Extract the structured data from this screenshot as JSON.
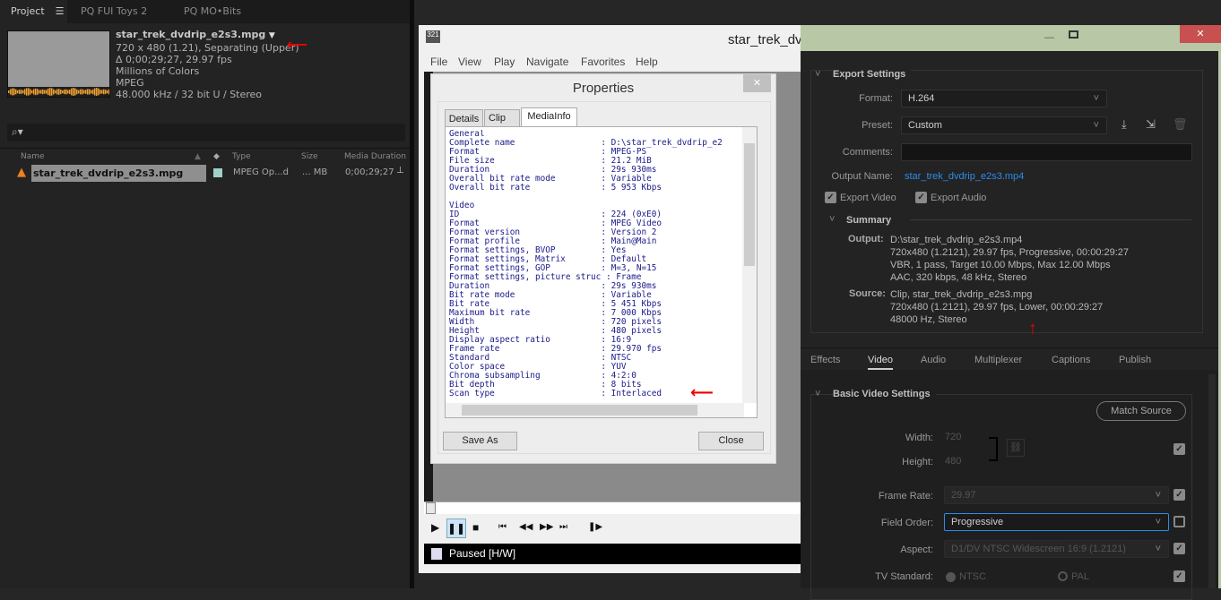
{
  "project_panel": {
    "tabs": [
      "Project",
      "PQ FUI Toys 2",
      "PQ MO•Bits"
    ],
    "menu_icon": "hamburger-icon",
    "clip_name": "star_trek_dvdrip_e2s3.mpg",
    "info_lines": [
      "720 x 480 (1.21), Separating (Upper)",
      "Δ 0;00;29;27, 29.97 fps",
      "Millions of Colors",
      "MPEG",
      "48.000 kHz / 32 bit U / Stereo"
    ],
    "columns": [
      "Name",
      "Type",
      "Size",
      "Media Duration"
    ],
    "rows": [
      {
        "name": "star_trek_dvdrip_e2s3.mpg",
        "type": "MPEG Op...d",
        "size": "... MB",
        "duration": "0;00;29;27",
        "label_color": "#9fd0c9"
      }
    ],
    "waveform_color": "#f0a030"
  },
  "mpc": {
    "title": "star_trek_dvd",
    "menu": [
      "File",
      "View",
      "Play",
      "Navigate",
      "Favorites",
      "Help"
    ],
    "status": "Paused [H/W]"
  },
  "properties": {
    "title": "Properties",
    "tabs": [
      "Details",
      "Clip",
      "MediaInfo"
    ],
    "active_tab": "MediaInfo",
    "mediainfo_text": "General\nComplete name                 : D:\\star_trek_dvdrip_e2\nFormat                        : MPEG-PS\nFile size                     : 21.2 MiB\nDuration                      : 29s 930ms\nOverall bit rate mode         : Variable\nOverall bit rate              : 5 953 Kbps\n\nVideo\nID                            : 224 (0xE0)\nFormat                        : MPEG Video\nFormat version                : Version 2\nFormat profile                : Main@Main\nFormat settings, BVOP         : Yes\nFormat settings, Matrix       : Default\nFormat settings, GOP          : M=3, N=15\nFormat settings, picture struc : Frame\nDuration                      : 29s 930ms\nBit rate mode                 : Variable\nBit rate                      : 5 451 Kbps\nMaximum bit rate              : 7 000 Kbps\nWidth                         : 720 pixels\nHeight                        : 480 pixels\nDisplay aspect ratio          : 16:9\nFrame rate                    : 29.970 fps\nStandard                      : NTSC\nColor space                   : YUV\nChroma subsampling            : 4:2:0\nBit depth                     : 8 bits\nScan type                     : Interlaced",
    "save_as": "Save As",
    "close": "Close"
  },
  "export": {
    "section": "Export Settings",
    "format_label": "Format:",
    "format": "H.264",
    "preset_label": "Preset:",
    "preset": "Custom",
    "comments_label": "Comments:",
    "comments": "",
    "output_name_label": "Output Name:",
    "output_name": "star_trek_dvdrip_e2s3.mp4",
    "export_video": "Export Video",
    "export_video_checked": true,
    "export_audio": "Export Audio",
    "export_audio_checked": true,
    "summary": "Summary",
    "output_label": "Output:",
    "output_lines": [
      "D:\\star_trek_dvdrip_e2s3.mp4",
      "720x480 (1.2121), 29.97 fps, Progressive, 00:00:29:27",
      "VBR, 1 pass, Target 10.00 Mbps, Max 12.00 Mbps",
      "AAC, 320 kbps, 48 kHz, Stereo"
    ],
    "source_label": "Source:",
    "source_lines": [
      "Clip, star_trek_dvdrip_e2s3.mpg",
      "720x480 (1.2121), 29.97 fps, Lower, 00:00:29:27",
      "48000 Hz, Stereo"
    ],
    "tabs": [
      "Effects",
      "Video",
      "Audio",
      "Multiplexer",
      "Captions",
      "Publish"
    ],
    "active_tab": "Video",
    "basic": {
      "title": "Basic Video Settings",
      "match_source": "Match Source",
      "width_label": "Width:",
      "width": "720",
      "height_label": "Height:",
      "height": "480",
      "frame_rate_label": "Frame Rate:",
      "frame_rate": "29.97",
      "field_order_label": "Field Order:",
      "field_order": "Progressive",
      "aspect_label": "Aspect:",
      "aspect": "D1/DV NTSC Widescreen 16:9 (1.2121)",
      "tv_label": "TV Standard:",
      "ntsc": "NTSC",
      "pal": "PAL",
      "tv_selected": "NTSC"
    },
    "accent": "#2d8ceb"
  }
}
